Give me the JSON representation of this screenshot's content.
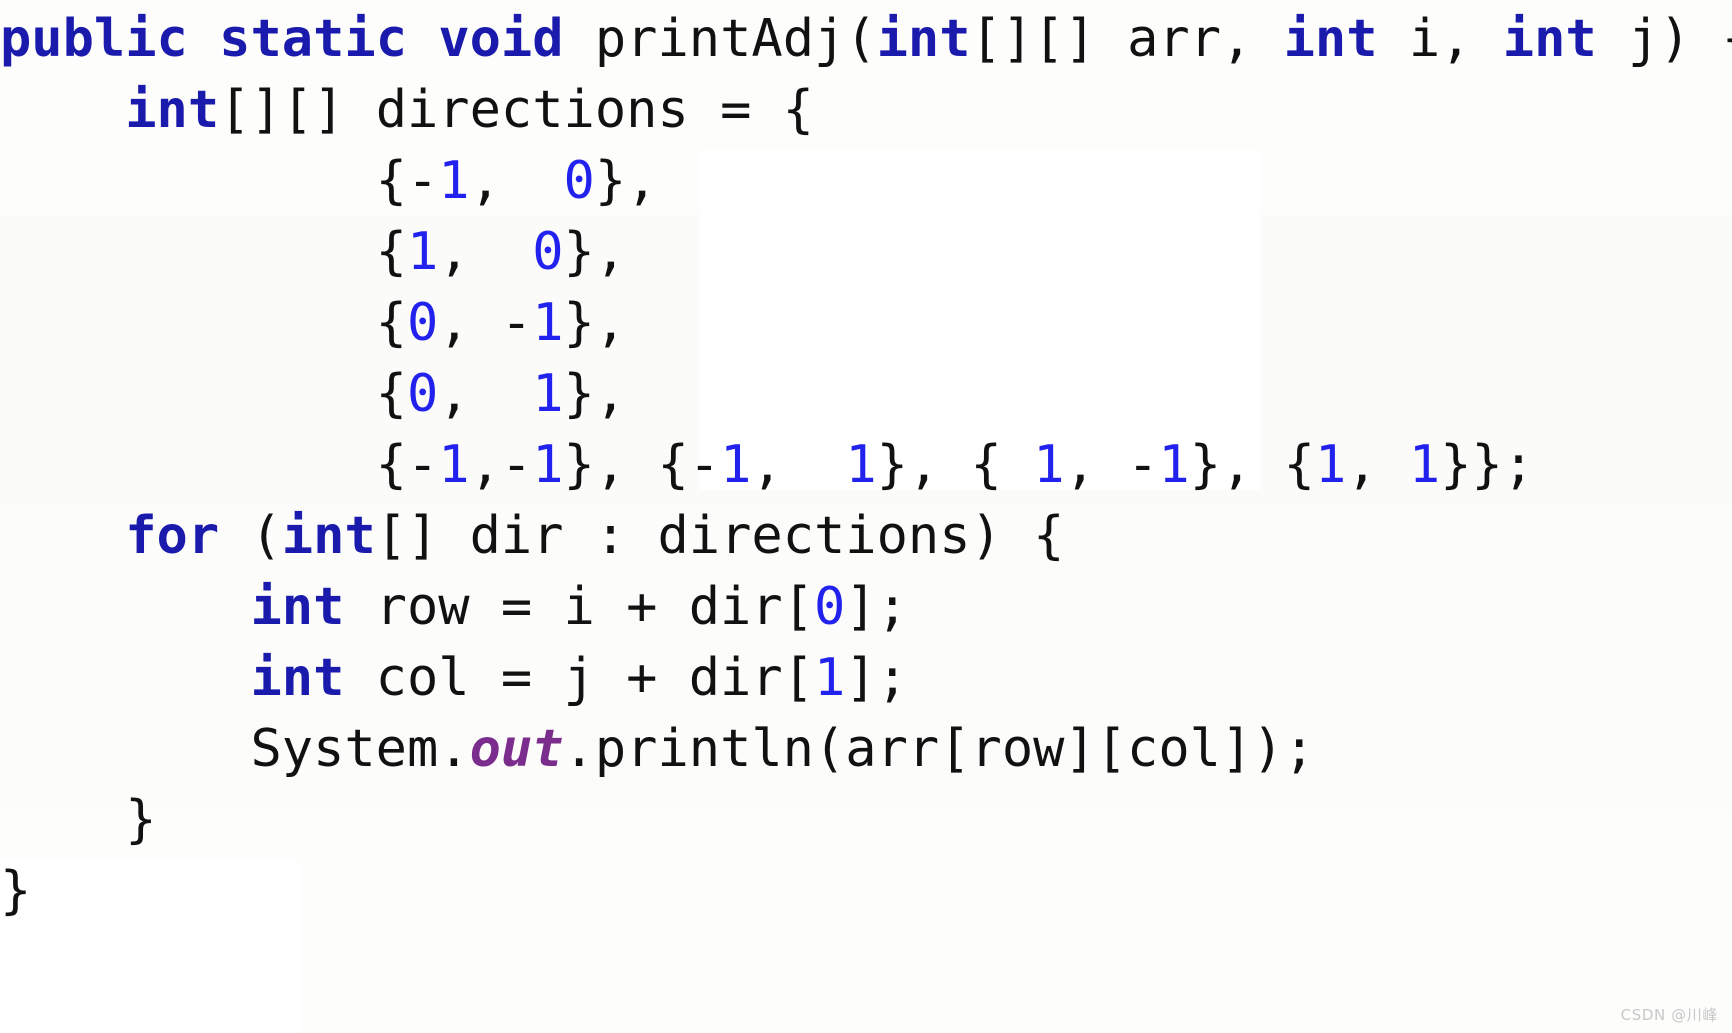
{
  "snapshot": {
    "kind": "code-snippet-image",
    "language": "Java",
    "background_color": "#fefefd"
  },
  "theme": {
    "keyword_color": "#1a1aad",
    "number_color": "#2222ee",
    "field_color": "#7b2d8e",
    "plain_color": "#111111",
    "watermark_color": "#c8c8c8"
  },
  "code": {
    "lines": [
      {
        "id": "line-1",
        "tokens": [
          {
            "t": "public",
            "k": "kw"
          },
          {
            "t": " ",
            "k": "plain"
          },
          {
            "t": "static",
            "k": "kw"
          },
          {
            "t": " ",
            "k": "plain"
          },
          {
            "t": "void",
            "k": "kw"
          },
          {
            "t": " printAdj(",
            "k": "plain"
          },
          {
            "t": "int",
            "k": "kw"
          },
          {
            "t": "[][] arr, ",
            "k": "plain"
          },
          {
            "t": "int",
            "k": "kw"
          },
          {
            "t": " i, ",
            "k": "plain"
          },
          {
            "t": "int",
            "k": "kw"
          },
          {
            "t": " j) {",
            "k": "plain"
          }
        ]
      },
      {
        "id": "line-2",
        "tokens": [
          {
            "t": "    ",
            "k": "plain"
          },
          {
            "t": "int",
            "k": "kw"
          },
          {
            "t": "[][] directions = {",
            "k": "plain"
          }
        ]
      },
      {
        "id": "line-3",
        "tokens": [
          {
            "t": "            {-",
            "k": "plain"
          },
          {
            "t": "1",
            "k": "num"
          },
          {
            "t": ",  ",
            "k": "plain"
          },
          {
            "t": "0",
            "k": "num"
          },
          {
            "t": "},",
            "k": "plain"
          }
        ]
      },
      {
        "id": "line-4",
        "tokens": [
          {
            "t": "            {",
            "k": "plain"
          },
          {
            "t": "1",
            "k": "num"
          },
          {
            "t": ",  ",
            "k": "plain"
          },
          {
            "t": "0",
            "k": "num"
          },
          {
            "t": "},",
            "k": "plain"
          }
        ]
      },
      {
        "id": "line-5",
        "tokens": [
          {
            "t": "            {",
            "k": "plain"
          },
          {
            "t": "0",
            "k": "num"
          },
          {
            "t": ", -",
            "k": "plain"
          },
          {
            "t": "1",
            "k": "num"
          },
          {
            "t": "},",
            "k": "plain"
          }
        ]
      },
      {
        "id": "line-6",
        "tokens": [
          {
            "t": "            {",
            "k": "plain"
          },
          {
            "t": "0",
            "k": "num"
          },
          {
            "t": ",  ",
            "k": "plain"
          },
          {
            "t": "1",
            "k": "num"
          },
          {
            "t": "},",
            "k": "plain"
          }
        ]
      },
      {
        "id": "line-7",
        "tokens": [
          {
            "t": "            {-",
            "k": "plain"
          },
          {
            "t": "1",
            "k": "num"
          },
          {
            "t": ",-",
            "k": "plain"
          },
          {
            "t": "1",
            "k": "num"
          },
          {
            "t": "}, {-",
            "k": "plain"
          },
          {
            "t": "1",
            "k": "num"
          },
          {
            "t": ",  ",
            "k": "plain"
          },
          {
            "t": "1",
            "k": "num"
          },
          {
            "t": "}, { ",
            "k": "plain"
          },
          {
            "t": "1",
            "k": "num"
          },
          {
            "t": ", -",
            "k": "plain"
          },
          {
            "t": "1",
            "k": "num"
          },
          {
            "t": "}, {",
            "k": "plain"
          },
          {
            "t": "1",
            "k": "num"
          },
          {
            "t": ", ",
            "k": "plain"
          },
          {
            "t": "1",
            "k": "num"
          },
          {
            "t": "}};",
            "k": "plain"
          }
        ]
      },
      {
        "id": "line-8",
        "tokens": [
          {
            "t": "    ",
            "k": "plain"
          },
          {
            "t": "for",
            "k": "kw"
          },
          {
            "t": " (",
            "k": "plain"
          },
          {
            "t": "int",
            "k": "kw"
          },
          {
            "t": "[] dir : directions) {",
            "k": "plain"
          }
        ]
      },
      {
        "id": "line-9",
        "tokens": [
          {
            "t": "        ",
            "k": "plain"
          },
          {
            "t": "int",
            "k": "kw"
          },
          {
            "t": " row = i + dir[",
            "k": "plain"
          },
          {
            "t": "0",
            "k": "num"
          },
          {
            "t": "];",
            "k": "plain"
          }
        ]
      },
      {
        "id": "line-10",
        "tokens": [
          {
            "t": "        ",
            "k": "plain"
          },
          {
            "t": "int",
            "k": "kw"
          },
          {
            "t": " col = j + dir[",
            "k": "plain"
          },
          {
            "t": "1",
            "k": "num"
          },
          {
            "t": "];",
            "k": "plain"
          }
        ]
      },
      {
        "id": "line-11",
        "tokens": [
          {
            "t": "        System.",
            "k": "plain"
          },
          {
            "t": "out",
            "k": "field"
          },
          {
            "t": ".println(arr[row][col]);",
            "k": "plain"
          }
        ]
      },
      {
        "id": "line-12",
        "tokens": [
          {
            "t": "    }",
            "k": "plain"
          }
        ]
      },
      {
        "id": "line-13",
        "tokens": [
          {
            "t": "}",
            "k": "plain"
          }
        ]
      }
    ]
  },
  "watermark": {
    "text": "CSDN @川峰"
  }
}
